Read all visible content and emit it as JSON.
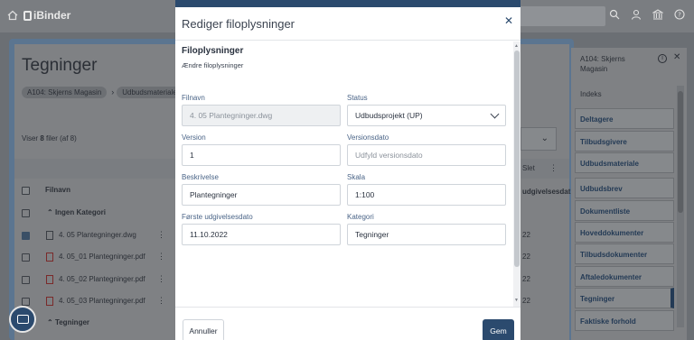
{
  "topbar": {
    "logo_text": "iBinder",
    "icons": [
      "home-icon",
      "search-icon",
      "user-icon",
      "bank-icon",
      "help-icon"
    ]
  },
  "background": {
    "page_title": "Tegninger",
    "breadcrumbs": [
      "A104: Skjerns Magasin",
      "Udbudsmateriale"
    ],
    "count_prefix": "Viser ",
    "count_bold": "8",
    "count_suffix": " filer (af 8)",
    "columns": {
      "filename": "Filnavn",
      "delete": "Slet",
      "published": "udgivelsesdat"
    },
    "rows": [
      {
        "kind": "group",
        "label": "Ingen Kategori"
      },
      {
        "kind": "file",
        "label": "4. 05 Plantegninger.dwg",
        "checked": true,
        "value": "22"
      },
      {
        "kind": "file",
        "label": "4. 05_01 Plantegninger.pdf",
        "checked": false,
        "value": "22"
      },
      {
        "kind": "file",
        "label": "4. 05_02 Plantegninger.pdf",
        "checked": false,
        "value": "22"
      },
      {
        "kind": "file",
        "label": "4. 05_03 Plantegninger.pdf",
        "checked": false,
        "value": "22"
      },
      {
        "kind": "group",
        "label": "Tegninger"
      }
    ]
  },
  "side_panel": {
    "title": "A104: Skjerns Magasin",
    "index_label": "Indeks",
    "items": [
      "Deltagere",
      "Tilbudsgivere",
      "Udbudsmateriale",
      "Udbudsbrev",
      "Dokumentliste",
      "Hoveddokumenter",
      "Tilbudsdokumenter",
      "Aftaledokumenter",
      "Tegninger",
      "Faktiske forhold"
    ],
    "active_item": "Tegninger"
  },
  "modal": {
    "title": "Rediger filoplysninger",
    "section_title": "Filoplysninger",
    "section_subtitle": "Ændre filoplysninger",
    "fields": {
      "filename": {
        "label": "Filnavn",
        "value": "4. 05 Plantegninger.dwg"
      },
      "status": {
        "label": "Status",
        "value": "Udbudsprojekt (UP)"
      },
      "version": {
        "label": "Version",
        "value": "1"
      },
      "version_date": {
        "label": "Versionsdato",
        "placeholder": "Udfyld versionsdato"
      },
      "description": {
        "label": "Beskrivelse",
        "value": "Plantegninger"
      },
      "scale": {
        "label": "Skala",
        "value": "1:100"
      },
      "first_published": {
        "label": "Første udgivelsesdato",
        "value": "11.10.2022"
      },
      "category": {
        "label": "Kategori",
        "value": "Tegninger"
      }
    },
    "cancel_label": "Annuller",
    "save_label": "Gem",
    "close_symbol": "✕"
  },
  "colors": {
    "accent": "#2b4a6e",
    "label": "#4a6487",
    "overlay": "#6b6f74"
  }
}
